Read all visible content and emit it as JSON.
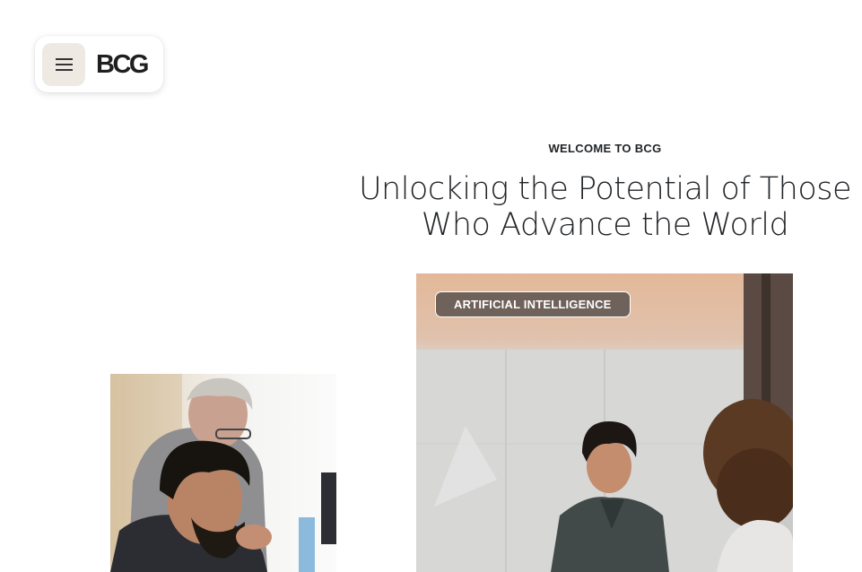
{
  "header": {
    "menu_icon": "hamburger-menu-icon",
    "logo_text": "BCG"
  },
  "hero": {
    "eyebrow": "WELCOME TO BCG",
    "headline_line1": "Unlocking the Potential of Those",
    "headline_line2": "Who Advance the World"
  },
  "feature_card": {
    "tag_label": "ARTIFICIAL INTELLIGENCE"
  },
  "colors": {
    "menu_button_bg": "#efe9e4",
    "tag_bg": "#6f625a",
    "text": "#212427"
  }
}
